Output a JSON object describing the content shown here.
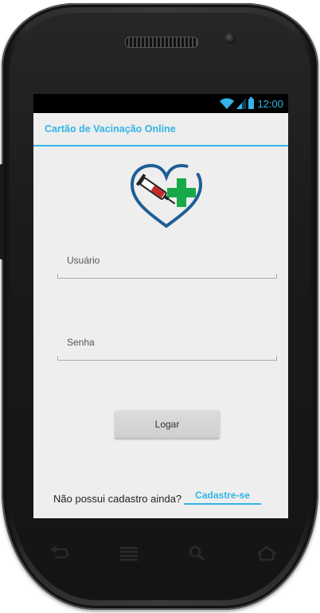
{
  "statusbar": {
    "time": "12:00",
    "icons": [
      "wifi-icon",
      "signal-icon",
      "battery-icon"
    ]
  },
  "app": {
    "title": "Cartão de Vacinação Online"
  },
  "form": {
    "username_label": "Usuário",
    "password_label": "Senha",
    "login_label": "Logar"
  },
  "signup": {
    "question": "Não possui cadastro ainda?",
    "link": "Cadastre-se"
  },
  "navbar": {
    "icons": [
      "back-icon",
      "menu-icon",
      "search-icon",
      "home-icon"
    ]
  },
  "colors": {
    "accent": "#33b5e5",
    "logo_heart": "#1f5e97",
    "logo_cross": "#17a84a",
    "syringe_red": "#c62b2b"
  }
}
